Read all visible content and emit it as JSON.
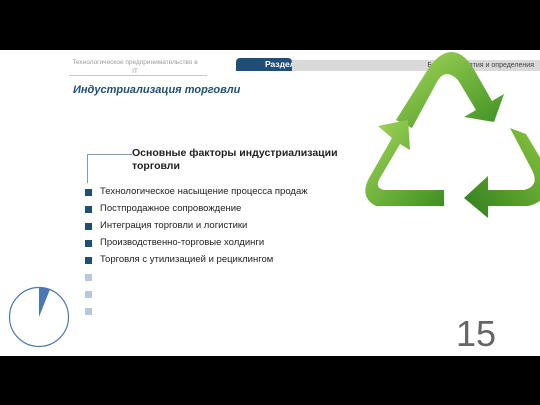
{
  "header": {
    "org_line": "Технологическое предпринимательство в",
    "org_line_tail": "IT",
    "section_label": "Раздел I",
    "section_title": "Базовые понятия и определения"
  },
  "page_title": "Индустриализация торговли",
  "factors_title": "Основные факторы индустриализации торговли",
  "bullets": [
    "Технологическое насыщение процесса продаж",
    "Постпродажное сопровождение",
    "Интеграция торговли и логистики",
    "Производственно-торговые холдинги",
    "Торговля с утилизацией и рециклингом",
    "",
    "",
    ""
  ],
  "page_number": "15",
  "progress_fraction": 0.06,
  "colors": {
    "accent": "#1f4e79",
    "bullet_light": "#b8c7df",
    "recycle_green_light": "#8cc63f",
    "recycle_green_dark": "#2e7d1e"
  },
  "icons": {
    "recycle": "recycle-icon"
  }
}
